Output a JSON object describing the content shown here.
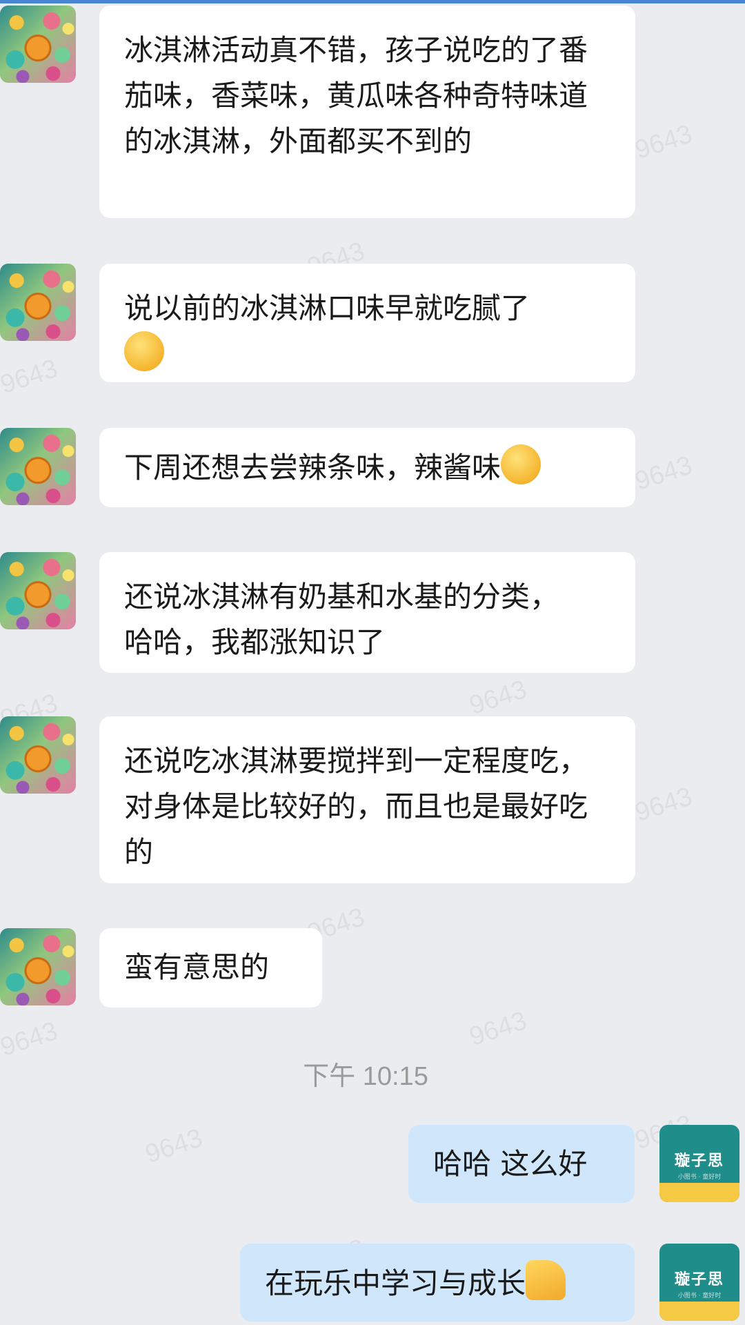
{
  "watermark_text": "9643",
  "messages_in": [
    {
      "text": "冰淇淋活动真不错，孩子说吃的了番茄味，香菜味，黄瓜味各种奇特味道的冰淇淋，外面都买不到的",
      "emoji": ""
    },
    {
      "text": "说以前的冰淇淋口味早就吃腻了",
      "emoji": "laughing-crying-emoji"
    },
    {
      "text": "下周还想去尝辣条味，辣酱味",
      "emoji": "thinking-emoji"
    },
    {
      "text": "还说冰淇淋有奶基和水基的分类，哈哈，我都涨知识了",
      "emoji": ""
    },
    {
      "text": "还说吃冰淇淋要搅拌到一定程度吃，对身体是比较好的，而且也是最好吃的",
      "emoji": ""
    },
    {
      "text": "蛮有意思的",
      "emoji": ""
    }
  ],
  "timestamp": "下午 10:15",
  "messages_out": [
    {
      "text": "哈哈 这么好",
      "emoji": ""
    },
    {
      "text": "在玩乐中学习与成长",
      "emoji": "thumbs-up-emoji"
    }
  ],
  "brand_avatar": {
    "name": "璇子思",
    "subtitle": "小图书 · 童好时"
  },
  "colors": {
    "background": "#ebecf0",
    "incoming_bubble": "#ffffff",
    "outgoing_bubble": "#cfe6fb",
    "top_bar": "#4a86d6",
    "brand_teal": "#1f8e8b",
    "brand_yellow": "#f5c944"
  }
}
